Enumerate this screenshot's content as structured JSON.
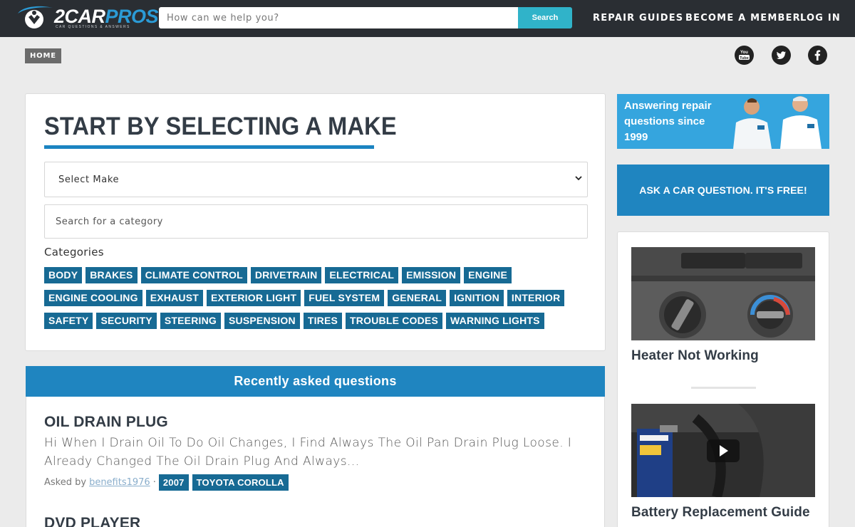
{
  "header": {
    "logo_main": "2CAR",
    "logo_accent": "PROS",
    "logo_tagline": "CAR QUESTIONS & ANSWERS",
    "search_placeholder": "How can we help you?",
    "search_button": "Search",
    "nav": [
      "REPAIR GUIDES",
      "BECOME A MEMBER",
      "LOG IN"
    ]
  },
  "breadcrumb": "HOME",
  "social": [
    "youtube-icon",
    "twitter-icon",
    "facebook-icon"
  ],
  "select_card": {
    "title": "START BY SELECTING A MAKE",
    "select_make": "Select Make",
    "category_search_placeholder": "Search for a category",
    "categories_label": "Categories",
    "categories": [
      [
        "BODY",
        "BRAKES",
        "CLIMATE CONTROL",
        "DRIVETRAIN",
        "ELECTRICAL",
        "EMISSION",
        "ENGINE"
      ],
      [
        "ENGINE COOLING",
        "EXHAUST",
        "EXTERIOR LIGHT",
        "FUEL SYSTEM",
        "GENERAL",
        "IGNITION",
        "INTERIOR"
      ],
      [
        "SAFETY",
        "SECURITY",
        "STEERING",
        "SUSPENSION",
        "TIRES",
        "TROUBLE CODES",
        "WARNING LIGHTS"
      ]
    ]
  },
  "recent": {
    "heading": "Recently asked questions",
    "questions": [
      {
        "title": "OIL DRAIN PLUG",
        "body": "Hi When I Drain Oil To Do Oil Changes, I Find Always The Oil Pan Drain Plug Loose. I Already Changed The Oil Drain Plug And Always...",
        "asked_by_label": "Asked by",
        "user": "benefits1976",
        "separator": "·",
        "tags": [
          "2007",
          "TOYOTA COROLLA"
        ]
      },
      {
        "title": "DVD PLAYER"
      }
    ]
  },
  "sidebar": {
    "promo_text": "Answering repair questions since 1999",
    "ask_button": "ASK A CAR QUESTION. IT'S FREE!",
    "guides": [
      {
        "title": "Heater Not Working"
      },
      {
        "title": "Battery Replacement Guide"
      }
    ]
  },
  "colors": {
    "header_bg": "#2a2e33",
    "accent_blue": "#1f85c0",
    "tag_blue": "#176a94",
    "search_button": "#30b3c9",
    "promo_bg": "#35a5de"
  }
}
